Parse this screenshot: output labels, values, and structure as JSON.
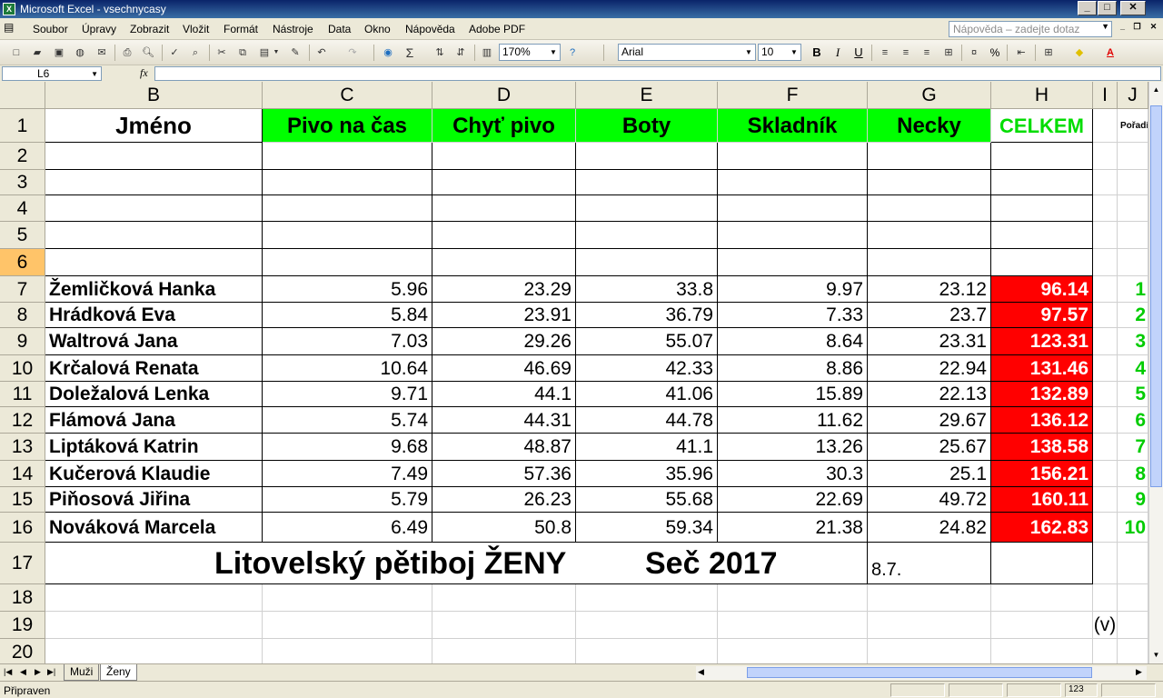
{
  "window": {
    "title": "Microsoft Excel - vsechnycasy"
  },
  "menu": [
    "Soubor",
    "Úpravy",
    "Zobrazit",
    "Vložit",
    "Formát",
    "Nástroje",
    "Data",
    "Okno",
    "Nápověda",
    "Adobe PDF"
  ],
  "help_placeholder": "Nápověda – zadejte dotaz",
  "toolbar": {
    "zoom": "170%",
    "font": "Arial",
    "font_size": "10",
    "bold": "B",
    "italic": "I",
    "underline": "U",
    "percent": "%",
    "sigma": "Σ"
  },
  "name_box": "L6",
  "fx_label": "fx",
  "columns": [
    "B",
    "C",
    "D",
    "E",
    "F",
    "G",
    "H",
    "I",
    "J"
  ],
  "rows": [
    "1",
    "2",
    "3",
    "4",
    "5",
    "6",
    "7",
    "8",
    "9",
    "10",
    "11",
    "12",
    "13",
    "14",
    "15",
    "16",
    "17",
    "18",
    "19",
    "20"
  ],
  "headers": {
    "name": "Jméno",
    "events": [
      "Pivo na čas",
      "Chyť pivo",
      "Boty",
      "Skladník",
      "Necky"
    ],
    "total": "CELKEM",
    "rank": "Pořadí"
  },
  "competitors": [
    {
      "name": "Žemličková Hanka",
      "scores": [
        "5.96",
        "23.29",
        "33.8",
        "9.97",
        "23.12"
      ],
      "total": "96.14",
      "rank": "1"
    },
    {
      "name": "Hrádková Eva",
      "scores": [
        "5.84",
        "23.91",
        "36.79",
        "7.33",
        "23.7"
      ],
      "total": "97.57",
      "rank": "2"
    },
    {
      "name": "Waltrová Jana",
      "scores": [
        "7.03",
        "29.26",
        "55.07",
        "8.64",
        "23.31"
      ],
      "total": "123.31",
      "rank": "3"
    },
    {
      "name": "Krčalová Renata",
      "scores": [
        "10.64",
        "46.69",
        "42.33",
        "8.86",
        "22.94"
      ],
      "total": "131.46",
      "rank": "4"
    },
    {
      "name": "Doležalová Lenka",
      "scores": [
        "9.71",
        "44.1",
        "41.06",
        "15.89",
        "22.13"
      ],
      "total": "132.89",
      "rank": "5"
    },
    {
      "name": "Flámová Jana",
      "scores": [
        "5.74",
        "44.31",
        "44.78",
        "11.62",
        "29.67"
      ],
      "total": "136.12",
      "rank": "6"
    },
    {
      "name": "Liptáková Katrin",
      "scores": [
        "9.68",
        "48.87",
        "41.1",
        "13.26",
        "25.67"
      ],
      "total": "138.58",
      "rank": "7"
    },
    {
      "name": "Kučerová Klaudie",
      "scores": [
        "7.49",
        "57.36",
        "35.96",
        "30.3",
        "25.1"
      ],
      "total": "156.21",
      "rank": "8"
    },
    {
      "name": "Piňosová Jiřina",
      "scores": [
        "5.79",
        "26.23",
        "55.68",
        "22.69",
        "49.72"
      ],
      "total": "160.11",
      "rank": "9"
    },
    {
      "name": "Nováková Marcela",
      "scores": [
        "6.49",
        "50.8",
        "59.34",
        "21.38",
        "24.82"
      ],
      "total": "162.83",
      "rank": "10"
    }
  ],
  "footer": {
    "title": "Litovelský pětiboj  ŽENY",
    "year": "Seč 2017",
    "date": "8.7."
  },
  "note_i19": "(v)",
  "sheets": [
    "Muži",
    "Ženy"
  ],
  "active_sheet": "Ženy",
  "status": {
    "ready": "Připraven",
    "num": "123"
  }
}
